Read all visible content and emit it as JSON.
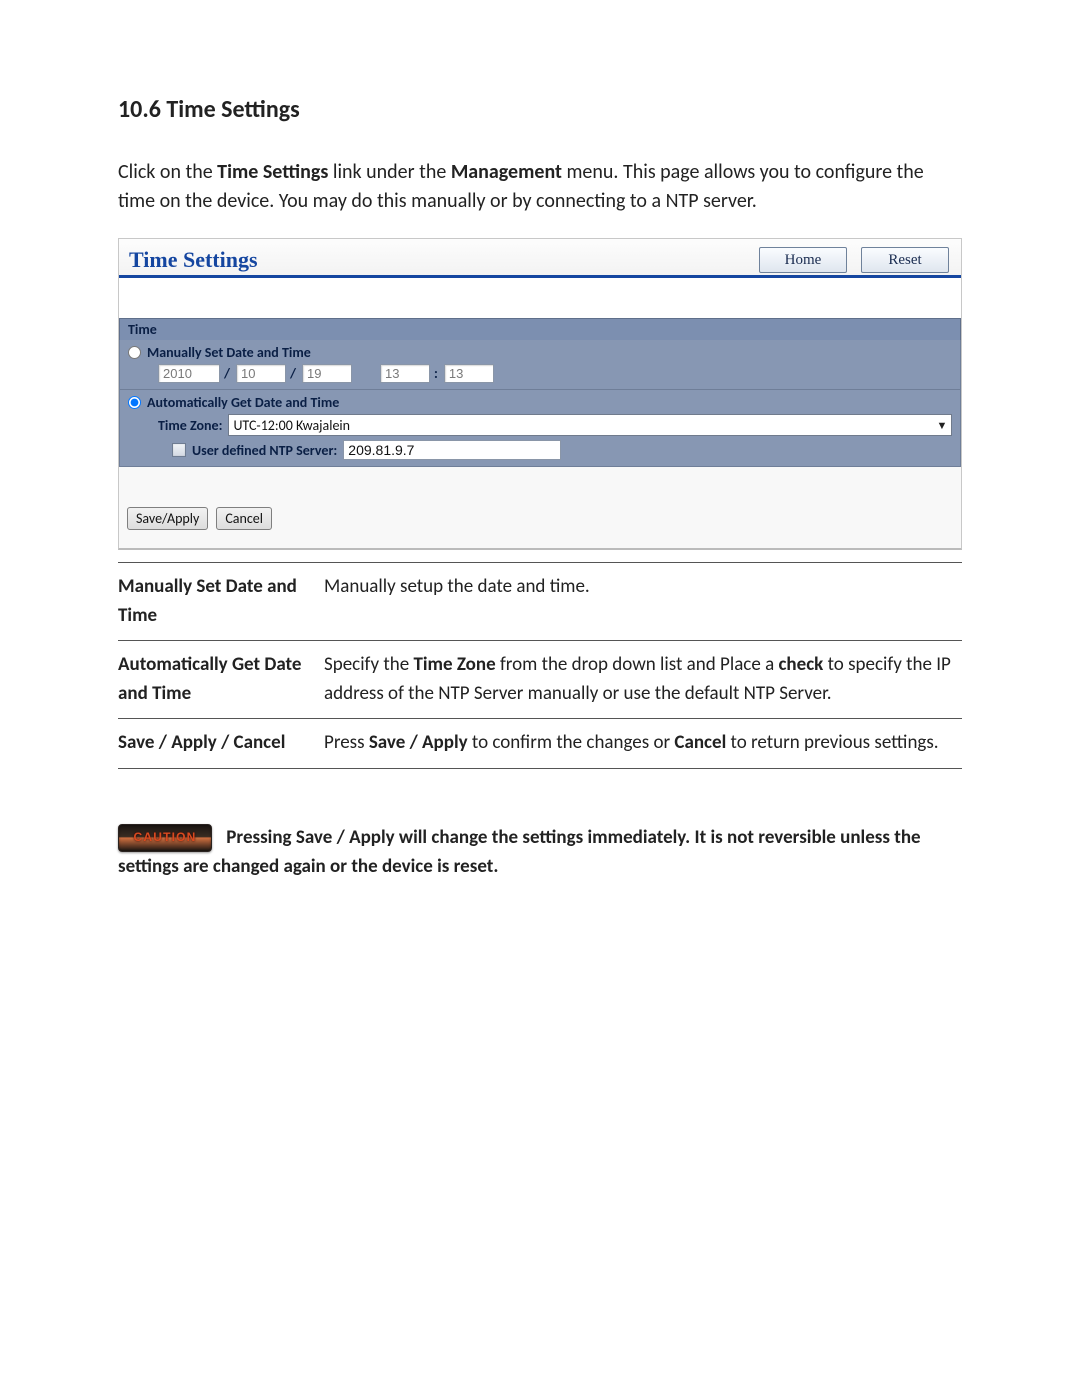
{
  "section_heading": "10.6 Time Settings",
  "intro": {
    "pre": "Click on the ",
    "link1": "Time Settings",
    "mid1": " link under the ",
    "menu": "Management",
    "post": " menu. This page allows you to configure the time on the device. You may do this manually or by connecting to a NTP server."
  },
  "screenshot": {
    "page_title": "Time Settings",
    "home_btn": "Home",
    "reset_btn": "Reset",
    "panel_title": "Time",
    "manual_radio_label": "Manually Set Date and Time",
    "year": "2010",
    "month": "10",
    "day": "19",
    "hour": "13",
    "minute": "13",
    "slash": "/",
    "colon": ":",
    "auto_radio_label": "Automatically Get Date and Time",
    "tz_label": "Time Zone:",
    "tz_value": "UTC-12:00 Kwajalein",
    "ntp_label": "User defined NTP Server:",
    "ntp_value": "209.81.9.7",
    "save_apply_btn": "Save/Apply",
    "cancel_btn": "Cancel"
  },
  "desc": [
    {
      "key": "Manually Set Date and Time",
      "val_plain": "Manually setup the date and time."
    },
    {
      "key": "Automatically Get Date and Time",
      "val_parts": [
        "Specify the ",
        "Time Zone",
        " from the drop down list and Place a ",
        "check",
        " to specify the IP address of the NTP Server manually or use the default NTP Server."
      ]
    },
    {
      "key": "Save / Apply / Cancel",
      "val_parts": [
        "Press ",
        "Save / Apply",
        " to confirm the changes or ",
        "Cancel",
        " to return previous settings."
      ]
    }
  ],
  "caution": {
    "badge": "CAUTION",
    "text": "Pressing Save / Apply will change the settings immediately. It is not reversible unless the settings are changed again or the device is reset."
  }
}
